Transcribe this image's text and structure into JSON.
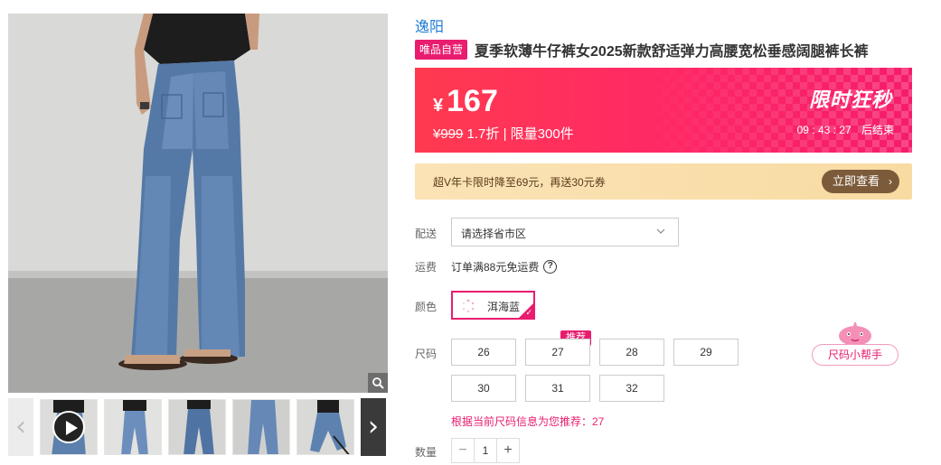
{
  "gallery": {
    "prev_arrow": "‹",
    "next_arrow": "›"
  },
  "product": {
    "brand": "逸阳",
    "badge": "唯品自营",
    "title": "夏季软薄牛仔裤女2025新款舒适弹力高腰宽松垂感阔腿裤长裤"
  },
  "flash_sale": {
    "currency": "¥",
    "price": "167",
    "original_price": "¥999",
    "discount": "1.7折",
    "limit": "| 限量300件",
    "label": "限时狂秒",
    "countdown": "09 : 43 : 27",
    "countdown_suffix": "后结束",
    "color_start": "#ff3a4f",
    "color_end": "#f51d6b"
  },
  "vip": {
    "text": "超V年卡限时降至69元，再送30元券",
    "button_label": "立即查看",
    "button_chevron": "›"
  },
  "options": {
    "delivery_label": "配送",
    "delivery_placeholder": "请选择省市区",
    "freight_label": "运费",
    "freight_text": "订单满88元免运费",
    "freight_help": "?",
    "color_label": "颜色",
    "color_selected": "洱海蓝",
    "size_label": "尺码",
    "sizes": [
      "26",
      "27",
      "28",
      "29",
      "30",
      "31",
      "32"
    ],
    "recommended_tag": "推荐",
    "size_helper": "尺码小帮手",
    "recommendation_text": "根据当前尺码信息为您推荐：27",
    "quantity_label": "数量",
    "quantity": "1",
    "minus": "−",
    "plus": "+"
  },
  "colors": {
    "accent": "#e91c6f",
    "brand_link": "#1a7ad4",
    "vip_button": "#7c5b3a"
  }
}
